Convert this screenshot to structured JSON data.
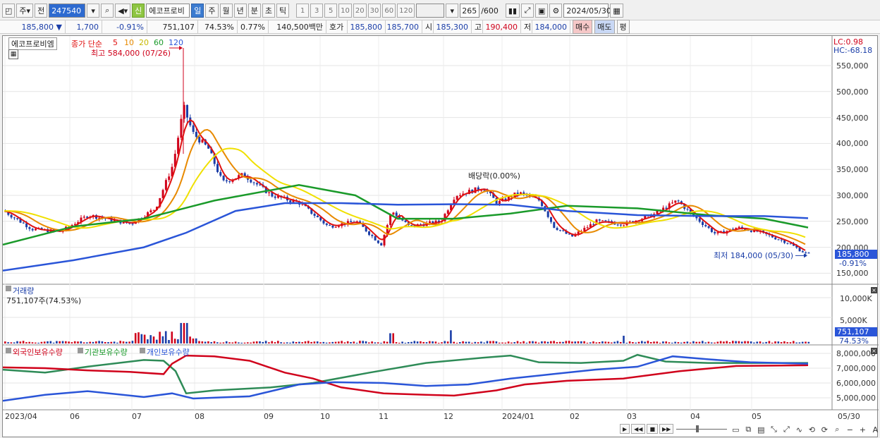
{
  "toolbar": {
    "market": "주",
    "period_sel": "전",
    "code": "247540",
    "badge": "신",
    "name": "에코프로비",
    "periods": [
      "일",
      "주",
      "월",
      "년",
      "분",
      "초",
      "틱"
    ],
    "active_period": "일",
    "nums": [
      "1",
      "3",
      "5",
      "10",
      "20",
      "30",
      "60",
      "120"
    ],
    "count": "265",
    "count_total": "/600",
    "date": "2024/05/30"
  },
  "quote": {
    "price": "185,800",
    "change_arrow": "▼",
    "change": "1,700",
    "change_pct": "-0.91%",
    "volume": "751,107",
    "vol_ratio": "74.53%",
    "turnover": "0.77%",
    "amount": "140,500백만",
    "ask_label": "호가",
    "ask": "185,800",
    "bid": "185,700",
    "open_label": "시",
    "open": "185,300",
    "high_label": "고",
    "high": "190,400",
    "low_label": "저",
    "low": "184,000",
    "buy": "매수",
    "sell": "매도",
    "eval": "평"
  },
  "price_panel": {
    "stock_label": "에코프로비엠",
    "ma_title": "종가 단순",
    "ma_periods": [
      {
        "label": "5",
        "color": "#e01010"
      },
      {
        "label": "10",
        "color": "#e88a00"
      },
      {
        "label": "20",
        "color": "#e8d800"
      },
      {
        "label": "60",
        "color": "#1a9a2a"
      },
      {
        "label": "120",
        "color": "#2a55d8"
      }
    ],
    "high_note": "최고 584,000 (07/26)",
    "low_note": "최저 184,000 (05/30)",
    "div_note": "배당락(0.00%)",
    "lc": "LC:0.98",
    "hc": "HC:-68.18",
    "y_ticks": [
      "550,000",
      "500,000",
      "450,000",
      "400,000",
      "350,000",
      "300,000",
      "250,000",
      "200,000",
      "150,000"
    ],
    "current_price": "185,800",
    "current_pct": "-0.91%"
  },
  "volume_panel": {
    "title": "거래량",
    "info": "751,107주(74.53%)",
    "y_ticks": [
      "10,000K",
      "5,000K"
    ],
    "current": "751,107",
    "current_pct": "74.53%"
  },
  "holding_panel": {
    "legend": [
      {
        "label": "외국인보유수량",
        "color": "#d0021b"
      },
      {
        "label": "기관보유수량",
        "color": "#1a9a2a"
      },
      {
        "label": "개인보유수량",
        "color": "#2a55d8"
      }
    ],
    "y_ticks": [
      "8,000,000",
      "7,000,000",
      "6,000,000",
      "5,000,000"
    ]
  },
  "x_axis": [
    "2023/04",
    "06",
    "07",
    "08",
    "09",
    "10",
    "11",
    "12",
    "2024/01",
    "02",
    "03",
    "04",
    "05"
  ],
  "x_end": "05/30",
  "colors": {
    "up": "#d0021b",
    "down": "#1b3ea8",
    "accent": "#2d6ad0"
  }
}
